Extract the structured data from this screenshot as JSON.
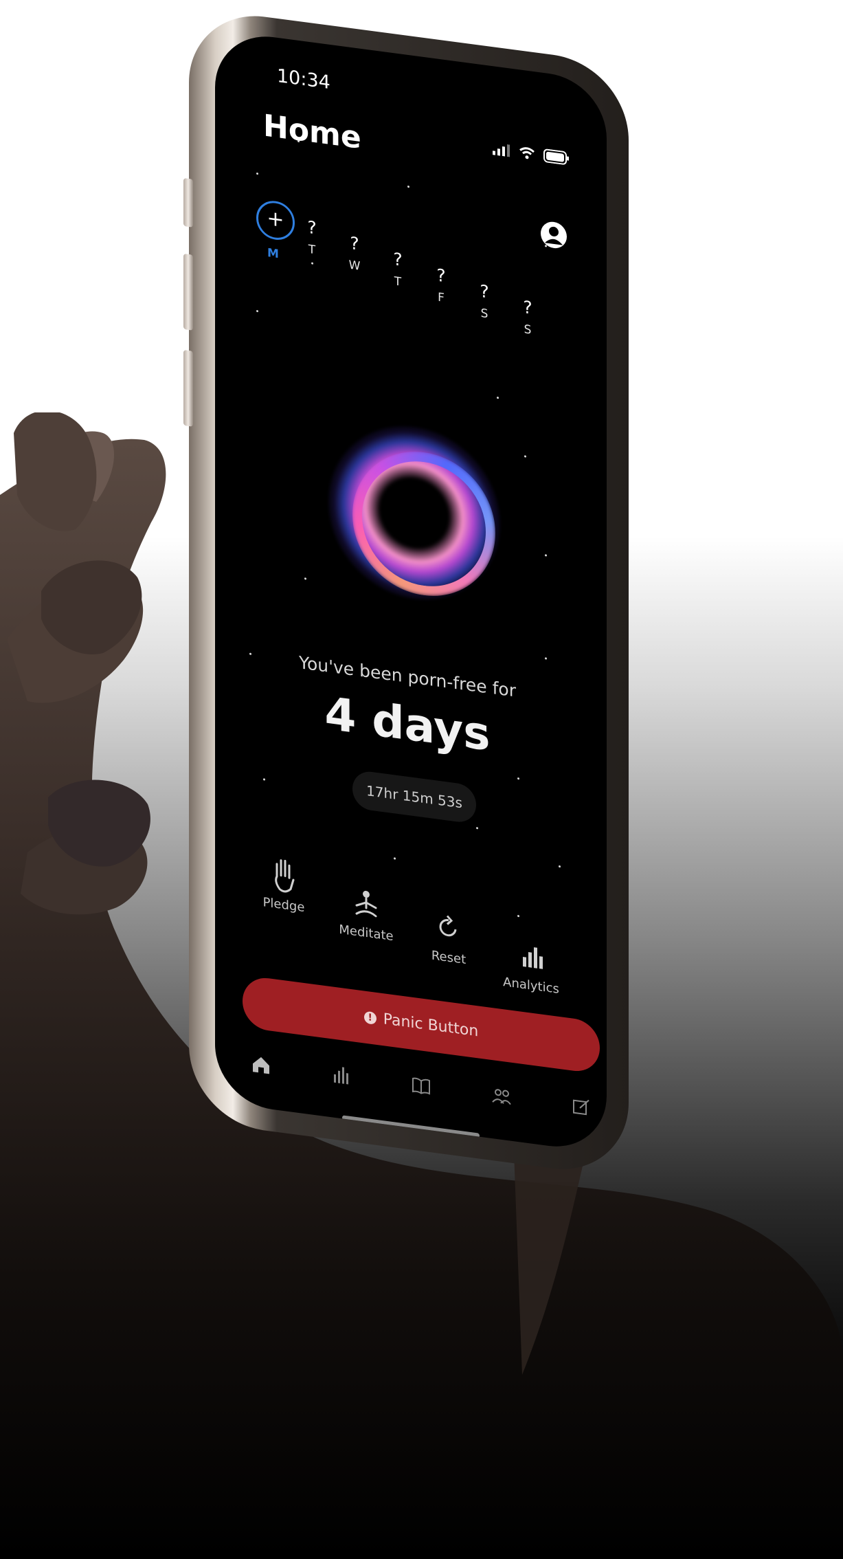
{
  "status_bar": {
    "time": "10:34"
  },
  "header": {
    "title": "Home"
  },
  "week": {
    "today_label": "M",
    "days": [
      {
        "mark": "?",
        "label": "T"
      },
      {
        "mark": "?",
        "label": "W"
      },
      {
        "mark": "?",
        "label": "T"
      },
      {
        "mark": "?",
        "label": "F"
      },
      {
        "mark": "?",
        "label": "S"
      },
      {
        "mark": "?",
        "label": "S"
      }
    ]
  },
  "streak": {
    "subtitle": "You've been porn-free for",
    "value": "4 days",
    "timer": "17hr 15m 53s"
  },
  "actions": [
    {
      "label": "Pledge",
      "icon": "hand-icon"
    },
    {
      "label": "Meditate",
      "icon": "meditate-icon"
    },
    {
      "label": "Reset",
      "icon": "reset-icon"
    },
    {
      "label": "Analytics",
      "icon": "analytics-icon"
    }
  ],
  "panic": {
    "label": "Panic Button",
    "color": "#9f1f23"
  },
  "tabbar": {
    "tabs": [
      {
        "icon": "home-icon",
        "active": true
      },
      {
        "icon": "stats-icon",
        "active": false
      },
      {
        "icon": "book-icon",
        "active": false
      },
      {
        "icon": "community-icon",
        "active": false
      },
      {
        "icon": "journal-icon",
        "active": false
      }
    ]
  },
  "colors": {
    "accent": "#2f7fe0",
    "background": "#000000",
    "panic": "#9f1f23"
  }
}
